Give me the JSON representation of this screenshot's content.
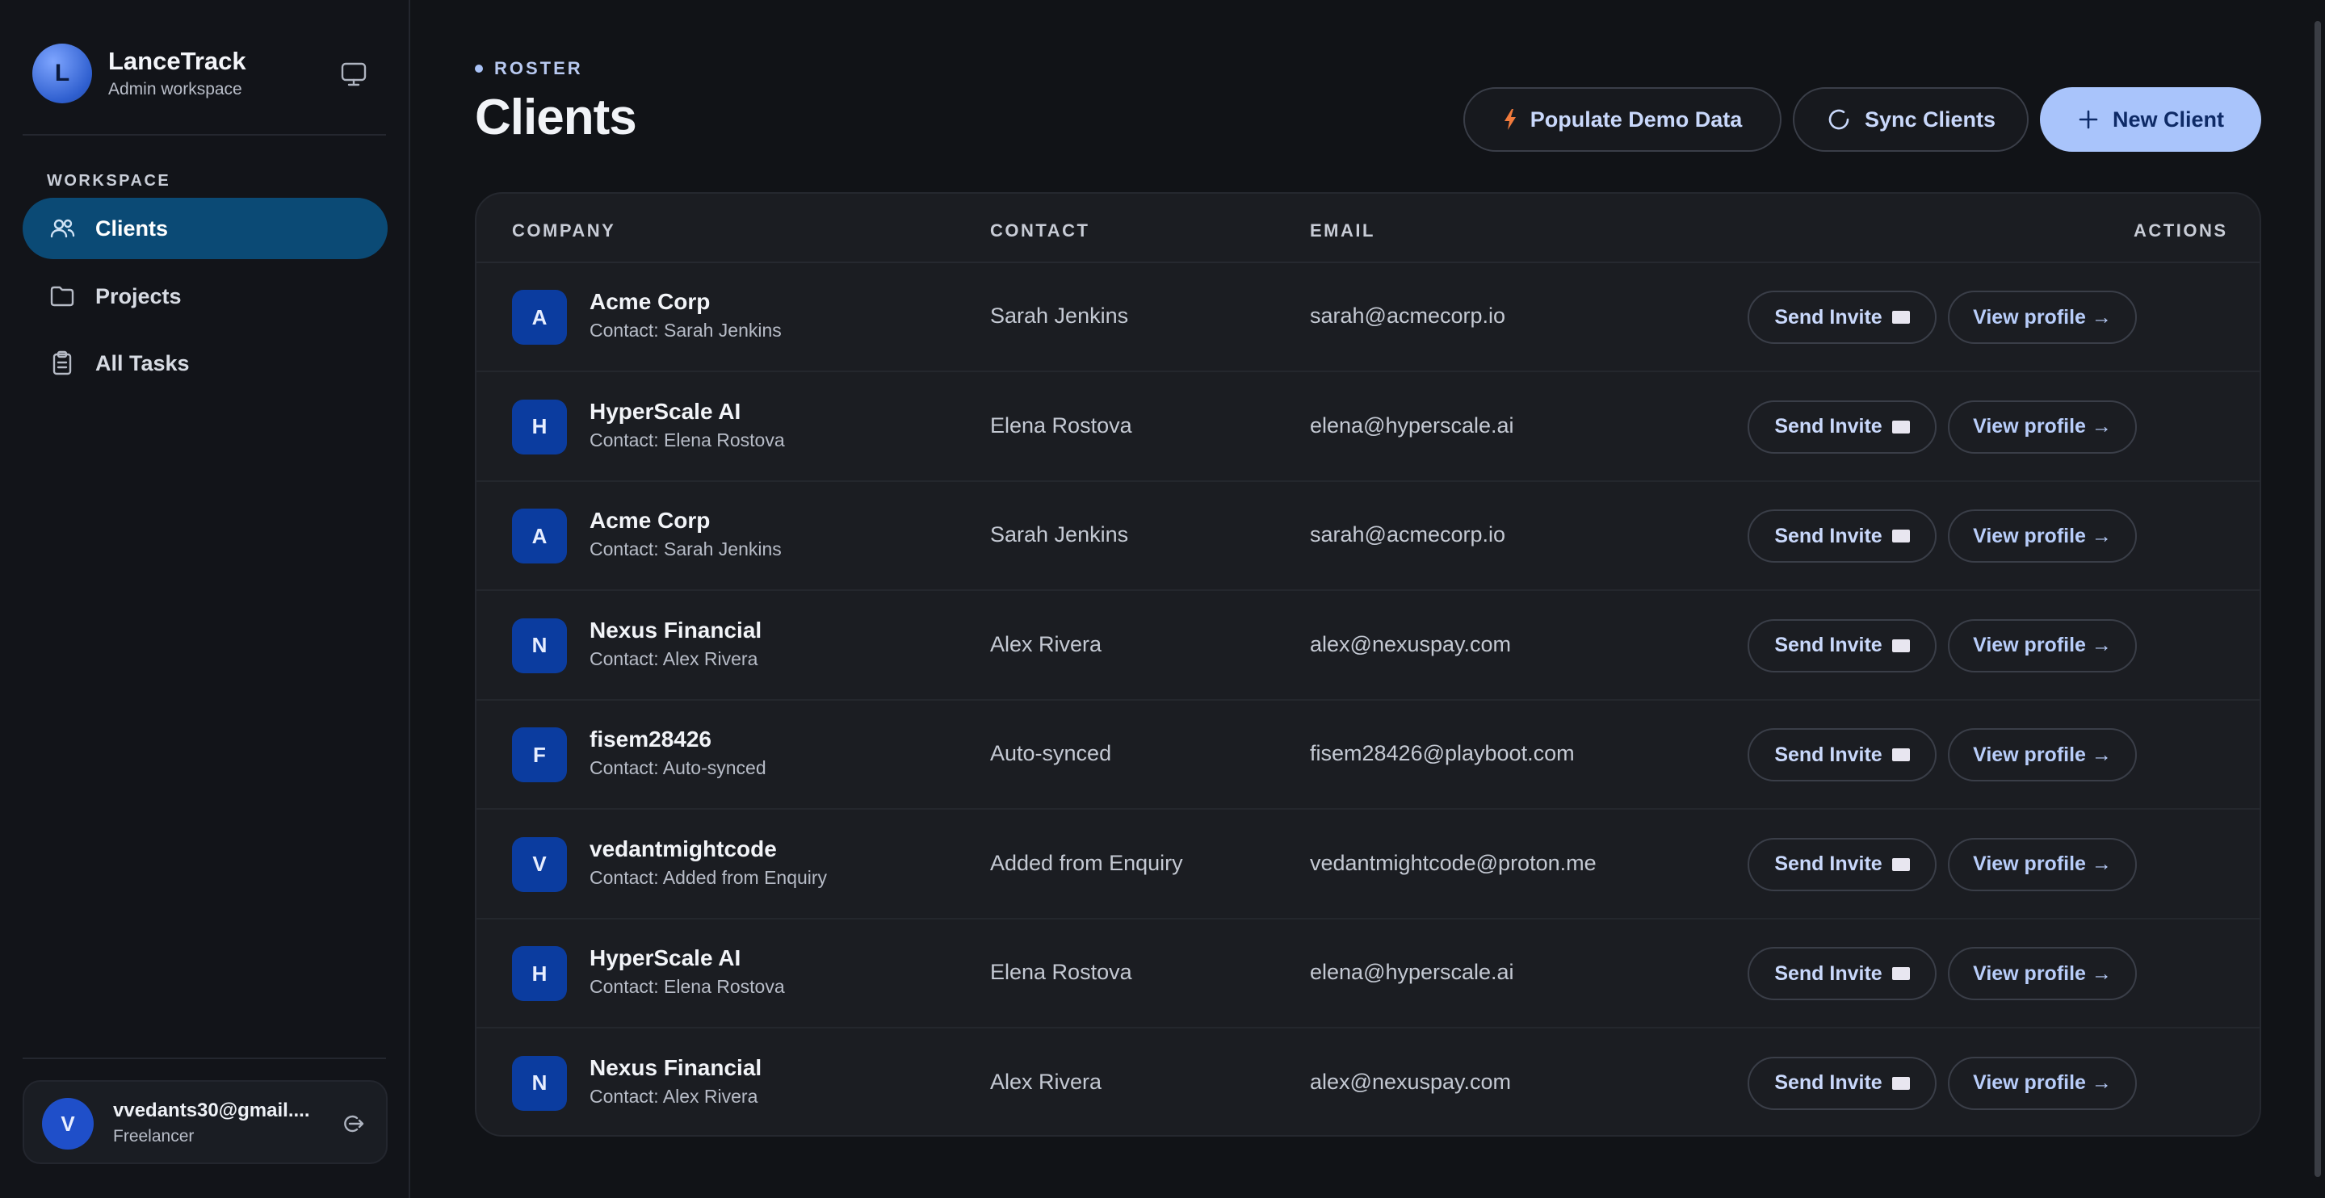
{
  "sidebar": {
    "brand": {
      "initial": "L",
      "title": "LanceTrack",
      "subtitle": "Admin workspace"
    },
    "section_label": "WORKSPACE",
    "items": [
      {
        "label": "Clients",
        "icon": "users-icon",
        "active": true
      },
      {
        "label": "Projects",
        "icon": "folder-icon",
        "active": false
      },
      {
        "label": "All Tasks",
        "icon": "clipboard-icon",
        "active": false
      }
    ],
    "user": {
      "initial": "V",
      "name": "vvedants30@gmail....",
      "role": "Freelancer"
    }
  },
  "header": {
    "eyebrow": "ROSTER",
    "title": "Clients",
    "buttons": {
      "populate": "Populate Demo Data",
      "sync": "Sync Clients",
      "new_client": "New Client"
    }
  },
  "table": {
    "columns": {
      "company": "COMPANY",
      "contact": "CONTACT",
      "email": "EMAIL",
      "actions": "ACTIONS"
    },
    "action_labels": {
      "invite": "Send Invite",
      "view": "View profile →"
    },
    "rows": [
      {
        "initial": "A",
        "company": "Acme Corp",
        "company_contact": "Contact: Sarah Jenkins",
        "contact": "Sarah Jenkins",
        "email": "sarah@acmecorp.io"
      },
      {
        "initial": "H",
        "company": "HyperScale AI",
        "company_contact": "Contact: Elena Rostova",
        "contact": "Elena Rostova",
        "email": "elena@hyperscale.ai"
      },
      {
        "initial": "A",
        "company": "Acme Corp",
        "company_contact": "Contact: Sarah Jenkins",
        "contact": "Sarah Jenkins",
        "email": "sarah@acmecorp.io"
      },
      {
        "initial": "N",
        "company": "Nexus Financial",
        "company_contact": "Contact: Alex Rivera",
        "contact": "Alex Rivera",
        "email": "alex@nexuspay.com"
      },
      {
        "initial": "F",
        "company": "fisem28426",
        "company_contact": "Contact: Auto-synced",
        "contact": "Auto-synced",
        "email": "fisem28426@playboot.com"
      },
      {
        "initial": "V",
        "company": "vedantmightcode",
        "company_contact": "Contact: Added from Enquiry",
        "contact": "Added from Enquiry",
        "email": "vedantmightcode@proton.me"
      },
      {
        "initial": "H",
        "company": "HyperScale AI",
        "company_contact": "Contact: Elena Rostova",
        "contact": "Elena Rostova",
        "email": "elena@hyperscale.ai"
      },
      {
        "initial": "N",
        "company": "Nexus Financial",
        "company_contact": "Contact: Alex Rivera",
        "contact": "Alex Rivera",
        "email": "alex@nexuspay.com"
      }
    ]
  },
  "colors": {
    "background": "#111317",
    "sidebar_active": "#0b4a75",
    "primary_button": "#a9c4fb",
    "avatar_tile": "#0b3c9f",
    "accent_text": "#c9d8fb"
  }
}
